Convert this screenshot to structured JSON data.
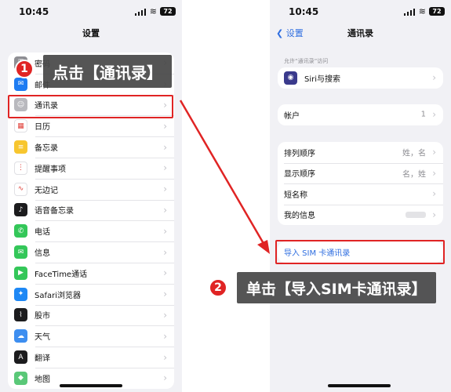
{
  "status": {
    "time": "10:45",
    "battery": "72"
  },
  "left": {
    "title": "设置",
    "rows": [
      {
        "label": "密码",
        "icon": "key-icon",
        "color": "#8e8e93",
        "glyph": "⚿"
      },
      {
        "label": "邮件",
        "icon": "mail-icon",
        "color": "#1e7cf2",
        "glyph": "✉"
      },
      {
        "label": "通讯录",
        "icon": "contacts-icon",
        "color": "#b9b9be",
        "glyph": "☺"
      },
      {
        "label": "日历",
        "icon": "calendar-icon",
        "color": "#ffffff",
        "glyph": "▦"
      },
      {
        "label": "备忘录",
        "icon": "notes-icon",
        "color": "#f7c62f",
        "glyph": "≡"
      },
      {
        "label": "提醒事项",
        "icon": "reminders-icon",
        "color": "#ffffff",
        "glyph": "⋮"
      },
      {
        "label": "无边记",
        "icon": "freeform-icon",
        "color": "#ffffff",
        "glyph": "∿"
      },
      {
        "label": "语音备忘录",
        "icon": "voice-memo-icon",
        "color": "#1c1c1e",
        "glyph": "♪"
      },
      {
        "label": "电话",
        "icon": "phone-icon",
        "color": "#34c759",
        "glyph": "✆"
      },
      {
        "label": "信息",
        "icon": "messages-icon",
        "color": "#34c759",
        "glyph": "✉"
      },
      {
        "label": "FaceTime通话",
        "icon": "facetime-icon",
        "color": "#34c759",
        "glyph": "▶"
      },
      {
        "label": "Safari浏览器",
        "icon": "safari-icon",
        "color": "#1e88f5",
        "glyph": "✦"
      },
      {
        "label": "股市",
        "icon": "stocks-icon",
        "color": "#1c1c1e",
        "glyph": "⌇"
      },
      {
        "label": "天气",
        "icon": "weather-icon",
        "color": "#3d8ef0",
        "glyph": "☁"
      },
      {
        "label": "翻译",
        "icon": "translate-icon",
        "color": "#1c1c1e",
        "glyph": "A"
      },
      {
        "label": "地图",
        "icon": "maps-icon",
        "color": "#5ac878",
        "glyph": "◆"
      }
    ]
  },
  "right": {
    "back": "设置",
    "title": "通讯录",
    "access_caption": "允许“通讯录”访问",
    "siri_label": "Siri与搜索",
    "accounts_label": "帐户",
    "accounts_value": "1",
    "sort_order_label": "排列顺序",
    "sort_order_value": "姓，名",
    "display_order_label": "显示顺序",
    "display_order_value": "名，姓",
    "short_name_label": "短名称",
    "my_info_label": "我的信息",
    "import_sim_label": "导入 SIM 卡通讯录"
  },
  "annotations": {
    "step1_number": "1",
    "step1_text": "点击【通讯录】",
    "step2_number": "2",
    "step2_text": "单击【导入SIM卡通讯录】",
    "accent": "#e02424"
  }
}
